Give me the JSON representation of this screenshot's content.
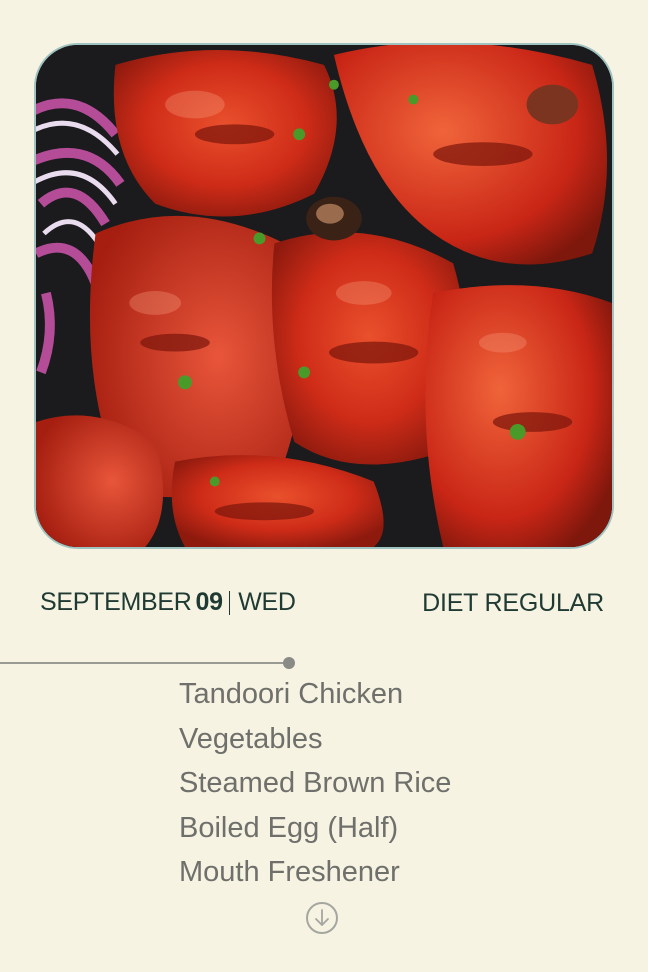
{
  "hero_image": {
    "icon": "tandoori-chicken-photo",
    "colors": {
      "chicken": "#d8321c",
      "char": "#8a1d10",
      "plate": "#1b1a1d",
      "onion": "#b64c9a",
      "herb": "#4a9a2a"
    }
  },
  "date": {
    "month": "SEPTEMBER",
    "day": "09",
    "weekday": "WED"
  },
  "diet": {
    "label": "DIET REGULAR"
  },
  "menu": {
    "items": [
      "Tandoori Chicken",
      "Vegetables",
      "Steamed Brown Rice",
      "Boiled Egg (Half)",
      "Mouth Freshener"
    ]
  },
  "scroll_down": {
    "icon": "arrow-down-circle-icon"
  }
}
